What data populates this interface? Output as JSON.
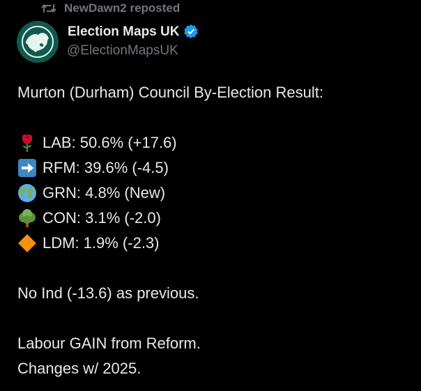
{
  "repost": {
    "text": "NewDawn2 reposted",
    "icon": "repost-icon"
  },
  "author": {
    "display_name": "Election Maps UK",
    "handle": "@ElectionMapsUK",
    "verified": true,
    "verified_color": "#1d9bf0",
    "avatar_icon": "globe-map-icon"
  },
  "tweet": {
    "heading": "Murton (Durham) Council By-Election Result:",
    "results": [
      {
        "icon": "rose-icon",
        "text": "LAB: 50.6% (+17.6)"
      },
      {
        "icon": "right-arrow-icon",
        "text": "RFM: 39.6% (-4.5)"
      },
      {
        "icon": "globe-icon",
        "text": "GRN: 4.8% (New)"
      },
      {
        "icon": "tree-icon",
        "text": "CON: 3.1% (-2.0)"
      },
      {
        "icon": "orange-diamond-icon",
        "text": "LDM: 1.9% (-2.3)"
      }
    ],
    "note": "No Ind (-13.6) as previous.",
    "summary_line1": "Labour GAIN from Reform.",
    "summary_line2": "Changes w/ 2025."
  },
  "colors": {
    "background": "#000000",
    "text": "#e7e9ea",
    "muted": "#71767b"
  }
}
